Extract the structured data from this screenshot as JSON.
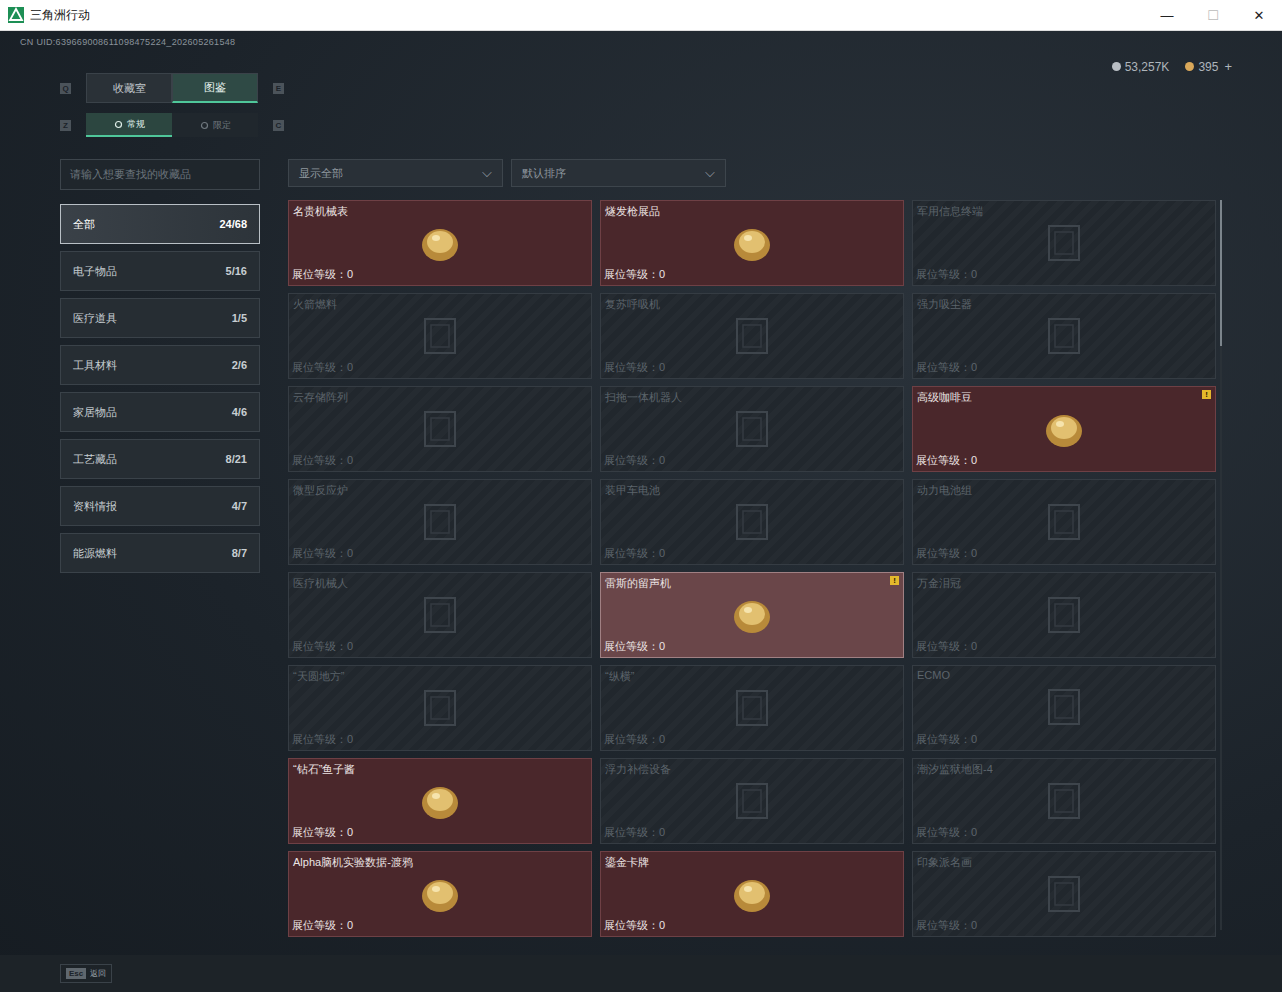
{
  "window": {
    "title": "三角洲行动",
    "controls": [
      "—",
      "☐",
      "✕"
    ]
  },
  "uid": "CN UID:639669008611098475224_202605261548",
  "currency": [
    {
      "amount": "53,257K",
      "color": "#b8bec4"
    },
    {
      "amount": "395",
      "color": "#d9a85a"
    }
  ],
  "add_button": "+",
  "main_tabs": {
    "prev_key": "Q",
    "next_key": "E",
    "items": [
      {
        "label": "收藏室",
        "selected": false
      },
      {
        "label": "图鉴",
        "selected": true
      }
    ]
  },
  "sub_tabs": {
    "prev_key": "Z",
    "next_key": "C",
    "items": [
      {
        "label": "常规",
        "selected": true
      },
      {
        "label": "限定",
        "selected": false
      }
    ]
  },
  "search": {
    "placeholder": "请输入想要查找的收藏品"
  },
  "filters": [
    {
      "label": "显示全部",
      "arrow": "⌵"
    },
    {
      "label": "默认排序",
      "arrow": "⌵"
    }
  ],
  "categories": [
    {
      "label": "全部",
      "count": "24/68",
      "selected": true
    },
    {
      "label": "电子物品",
      "count": "5/16",
      "selected": false
    },
    {
      "label": "医疗道具",
      "count": "1/5",
      "selected": false
    },
    {
      "label": "工具材料",
      "count": "2/6",
      "selected": false
    },
    {
      "label": "家居物品",
      "count": "4/6",
      "selected": false
    },
    {
      "label": "工艺藏品",
      "count": "8/21",
      "selected": false
    },
    {
      "label": "资料情报",
      "count": "4/7",
      "selected": false
    },
    {
      "label": "能源燃料",
      "count": "8/7",
      "selected": false
    }
  ],
  "level_label": "展位等级：",
  "new_badge_text": "!",
  "items": [
    {
      "name": "名贵机械表",
      "collected": true,
      "new": false,
      "highlighted": false,
      "display_level": "0"
    },
    {
      "name": "燧发枪展品",
      "collected": true,
      "new": false,
      "highlighted": false,
      "display_level": "0"
    },
    {
      "name": "军用信息终端",
      "collected": false,
      "new": false,
      "highlighted": false,
      "display_level": "0"
    },
    {
      "name": "火箭燃料",
      "collected": false,
      "new": false,
      "highlighted": false,
      "display_level": "0"
    },
    {
      "name": "复苏呼吸机",
      "collected": false,
      "new": false,
      "highlighted": false,
      "display_level": "0"
    },
    {
      "name": "强力吸尘器",
      "collected": false,
      "new": false,
      "highlighted": false,
      "display_level": "0"
    },
    {
      "name": "云存储阵列",
      "collected": false,
      "new": false,
      "highlighted": false,
      "display_level": "0"
    },
    {
      "name": "扫拖一体机器人",
      "collected": false,
      "new": false,
      "highlighted": false,
      "display_level": "0"
    },
    {
      "name": "高级咖啡豆",
      "collected": true,
      "new": true,
      "highlighted": false,
      "display_level": "0"
    },
    {
      "name": "微型反应炉",
      "collected": false,
      "new": false,
      "highlighted": false,
      "display_level": "0"
    },
    {
      "name": "装甲车电池",
      "collected": false,
      "new": false,
      "highlighted": false,
      "display_level": "0"
    },
    {
      "name": "动力电池组",
      "collected": false,
      "new": false,
      "highlighted": false,
      "display_level": "0"
    },
    {
      "name": "医疗机械人",
      "collected": false,
      "new": false,
      "highlighted": false,
      "display_level": "0"
    },
    {
      "name": "雷斯的留声机",
      "collected": true,
      "new": true,
      "highlighted": true,
      "display_level": "0"
    },
    {
      "name": "万金泪冠",
      "collected": false,
      "new": false,
      "highlighted": false,
      "display_level": "0"
    },
    {
      "name": "“天圆地方”",
      "collected": false,
      "new": false,
      "highlighted": false,
      "display_level": "0"
    },
    {
      "name": "“纵横”",
      "collected": false,
      "new": false,
      "highlighted": false,
      "display_level": "0"
    },
    {
      "name": "ECMO",
      "collected": false,
      "new": false,
      "highlighted": false,
      "display_level": "0"
    },
    {
      "name": "“钻石”鱼子酱",
      "collected": true,
      "new": false,
      "highlighted": false,
      "display_level": "0"
    },
    {
      "name": "浮力补偿设备",
      "collected": false,
      "new": false,
      "highlighted": false,
      "display_level": "0"
    },
    {
      "name": "潮汐监狱地图-4",
      "collected": false,
      "new": false,
      "highlighted": false,
      "display_level": "0"
    },
    {
      "name": "Alpha脑机实验数据-渡鸦",
      "collected": true,
      "new": false,
      "highlighted": false,
      "display_level": "0"
    },
    {
      "name": "鎏金卡牌",
      "collected": true,
      "new": false,
      "highlighted": false,
      "display_level": "0"
    },
    {
      "name": "印象派名画",
      "collected": false,
      "new": false,
      "highlighted": false,
      "display_level": "0"
    }
  ],
  "scrollbar": {
    "offset": 0.2,
    "level": 0.2
  },
  "footer": {
    "key": "Esc",
    "label": "返回"
  }
}
